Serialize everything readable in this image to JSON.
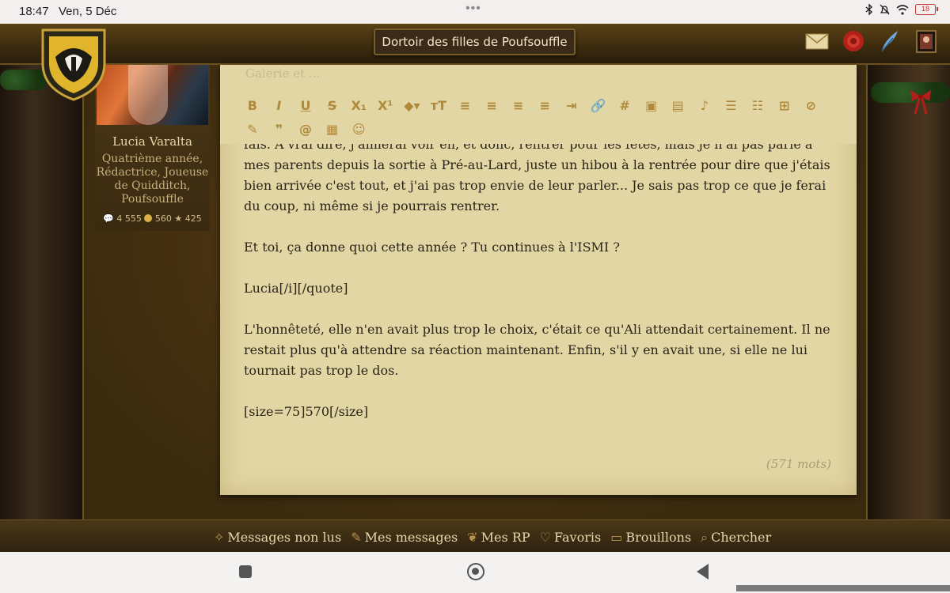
{
  "status_bar": {
    "time": "18:47",
    "date": "Ven, 5 Déc",
    "more_dots": "•••",
    "battery": "18"
  },
  "header": {
    "room_title": "Dortoir des filles de Poufsouffle",
    "icons": [
      "mail-icon",
      "seal-icon",
      "quill-icon",
      "portrait-icon"
    ]
  },
  "profile": {
    "name": "Lucia Varalta",
    "role": "Quatrième année, Rédactrice, Joueuse de Quidditch, Poufsouffle",
    "posts": "4 555",
    "gold": "560",
    "stars": "425"
  },
  "editor": {
    "hidden_top_text": "Galerie et ...",
    "toolbar_row1": [
      "B",
      "I",
      "U",
      "S",
      "X₁",
      "X¹",
      "◆▾",
      "ᴛT",
      "≡",
      "≡",
      "≡",
      "≡",
      "⇥",
      "🔗",
      "#",
      "▣",
      "▤",
      "♪",
      "☰",
      "☷",
      "⊞",
      "⊘"
    ],
    "toolbar_row2": [
      "✎",
      "❞",
      "@",
      "▦",
      "☺"
    ],
    "paragraphs": [
      "fais. A vrai dire, j'aimerai voir en, et donc, rentrer pour les fêtes, mais je n'ai pas parlé à mes parents depuis la sortie à Pré-au-Lard, juste un hibou à la rentrée pour dire que j'étais bien arrivée c'est tout, et j'ai pas trop envie de leur parler... Je sais pas trop ce que je ferai du coup, ni même si je pourrais rentrer.",
      "Et toi, ça donne quoi cette année ? Tu continues à l'ISMI ?",
      "Lucia[/i][/quote]",
      "L'honnêteté, elle n'en avait plus trop le choix, c'était ce qu'Ali attendait certainement. Il ne restait plus qu'à attendre sa réaction maintenant. Enfin, s'il y en avait une, si elle ne lui tournait pas trop le dos.",
      "[size=75]570[/size]"
    ],
    "word_count": "(571 mots)"
  },
  "bottom_nav": {
    "items": [
      {
        "icon": "✧",
        "label": "Messages non lus"
      },
      {
        "icon": "✎",
        "label": "Mes messages"
      },
      {
        "icon": "❦",
        "label": "Mes RP"
      },
      {
        "icon": "♡",
        "label": "Favoris"
      },
      {
        "icon": "▭",
        "label": "Brouillons"
      },
      {
        "icon": "⌕",
        "label": "Chercher"
      }
    ]
  },
  "colors": {
    "parchment": "#e2d6a4",
    "gold_text": "#e8d7aa",
    "toolbar_icon": "#b08a3c",
    "header_brown": "#3b2a0e"
  }
}
